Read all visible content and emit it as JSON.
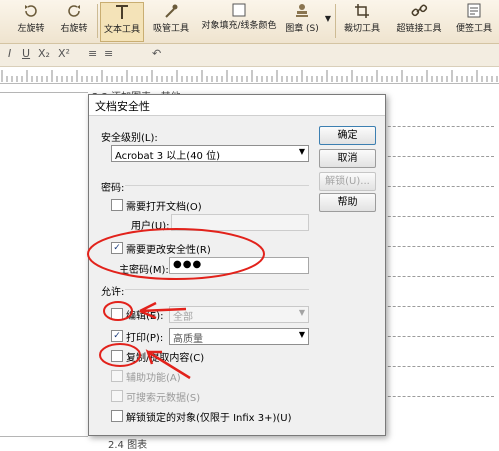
{
  "toolbar": {
    "buttons": [
      {
        "label": "左旋转",
        "icon": "rotate-left-icon"
      },
      {
        "label": "右旋转",
        "icon": "rotate-right-icon"
      },
      {
        "label": "文本工具",
        "icon": "text-tool-icon"
      },
      {
        "label": "吸管工具",
        "icon": "eyedropper-icon"
      },
      {
        "label": "对象填充/线条颜色",
        "icon": "fill-color-icon"
      },
      {
        "label": "图章 (S)",
        "icon": "stamp-icon"
      },
      {
        "label": "裁切工具",
        "icon": "crop-icon"
      },
      {
        "label": "超链接工具",
        "icon": "hyperlink-icon"
      },
      {
        "label": "便签工具",
        "icon": "note-icon"
      }
    ]
  },
  "format_bar": {
    "items": [
      "I",
      "U",
      "X₂",
      "X²",
      "≡",
      "≡",
      "↶"
    ]
  },
  "document": {
    "partial_text": "2.3 添加图表 · 其他",
    "bottom_text": "2.4 图表"
  },
  "dialog": {
    "title": "文档安全性",
    "security_level_label": "安全级别(L):",
    "security_level_value": "Acrobat 3 以上(40 位)",
    "password_group": "密码:",
    "require_open_label": "需要打开文档(O)",
    "user_label": "用户(U):",
    "require_change_label": "需要更改安全性(R)",
    "master_label": "主密码(M):",
    "master_value": "●●●",
    "permissions_group": "允许:",
    "edit_label": "编辑(E):",
    "edit_value": "全部",
    "print_label": "打印(P):",
    "print_value": "高质量",
    "copy_label": "复制/提取内容(C)",
    "accessibility_label": "辅助功能(A)",
    "searchable_label": "可搜索元数据(S)",
    "unlock_locked_label": "解锁锁定的对象(仅限于 Infix 3+)(U)",
    "buttons": {
      "ok": "确定",
      "cancel": "取消",
      "unlock": "解锁(U)...",
      "help": "帮助"
    }
  },
  "colors": {
    "annotation": "#e2221b",
    "toolbar_bg": "#f2e8d5",
    "dialog_bg": "#f0f0f0"
  }
}
